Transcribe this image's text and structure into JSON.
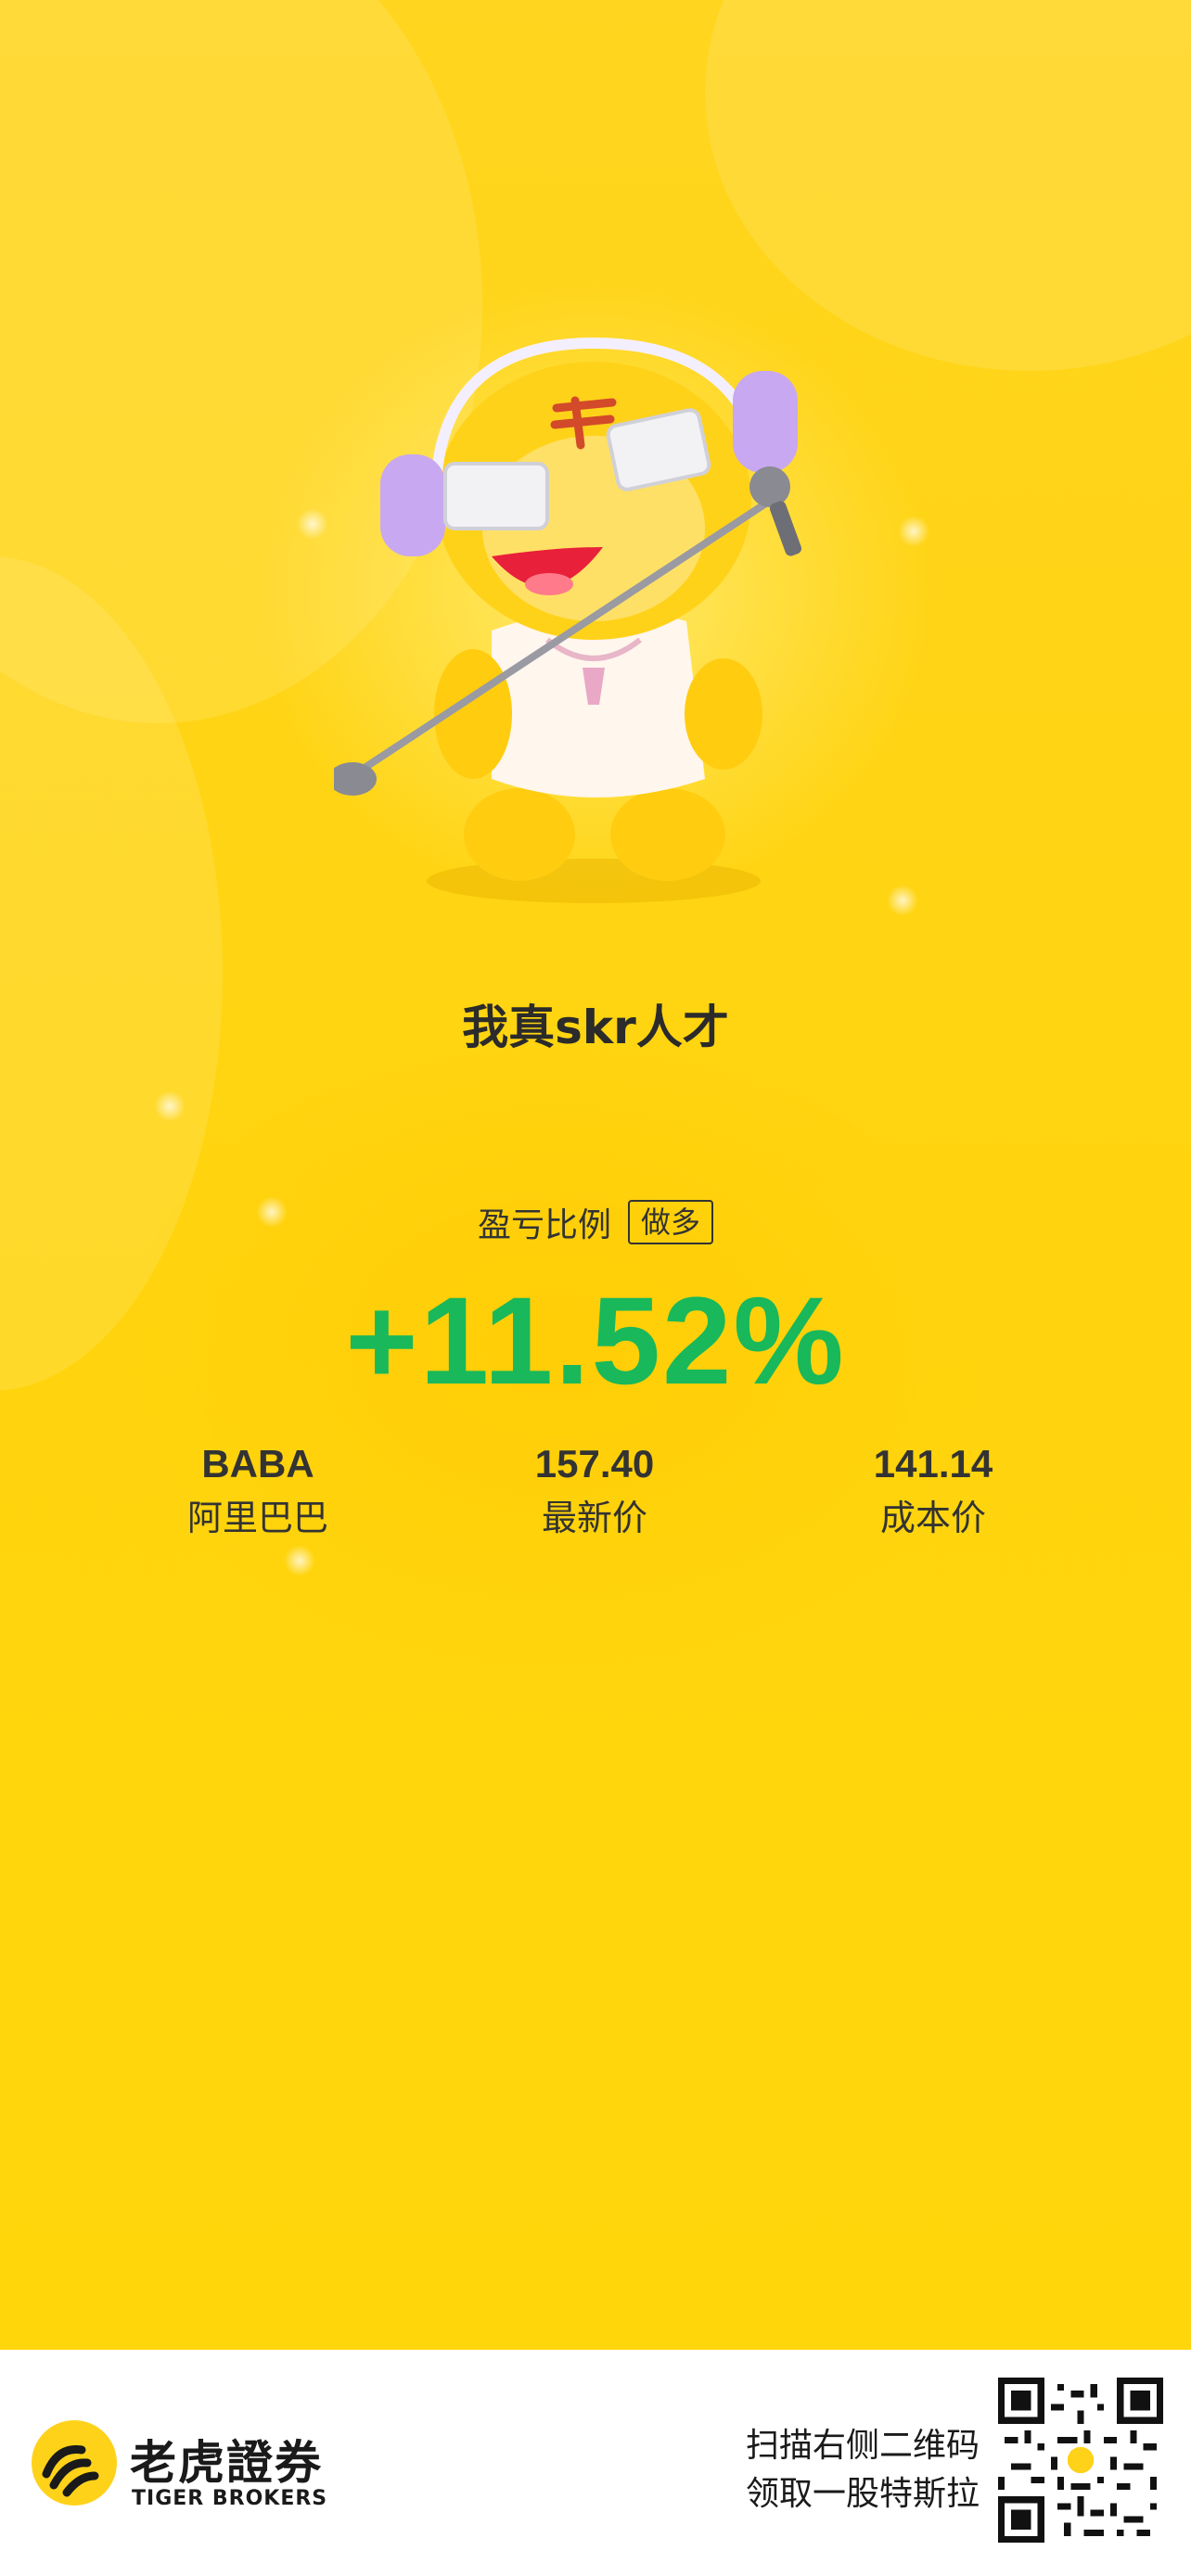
{
  "poster": {
    "headline": "我真skr人才",
    "ratio_label": "盈亏比例",
    "direction_badge": "做多",
    "pnl_percent": "+11.52%",
    "stats": [
      {
        "value": "BABA",
        "label": "阿里巴巴"
      },
      {
        "value": "157.40",
        "label": "最新价"
      },
      {
        "value": "141.14",
        "label": "成本价"
      }
    ]
  },
  "footer": {
    "brand_cn": "老虎證券",
    "brand_en": "TIGER BROKERS",
    "promo_line1": "扫描右侧二维码",
    "promo_line2": "领取一股特斯拉"
  },
  "colors": {
    "background": "#ffd51f",
    "pnl_green": "#19b85a",
    "text": "#333333"
  },
  "icons": [
    "tiger-mascot",
    "tiger-logo-icon",
    "qr-code"
  ]
}
